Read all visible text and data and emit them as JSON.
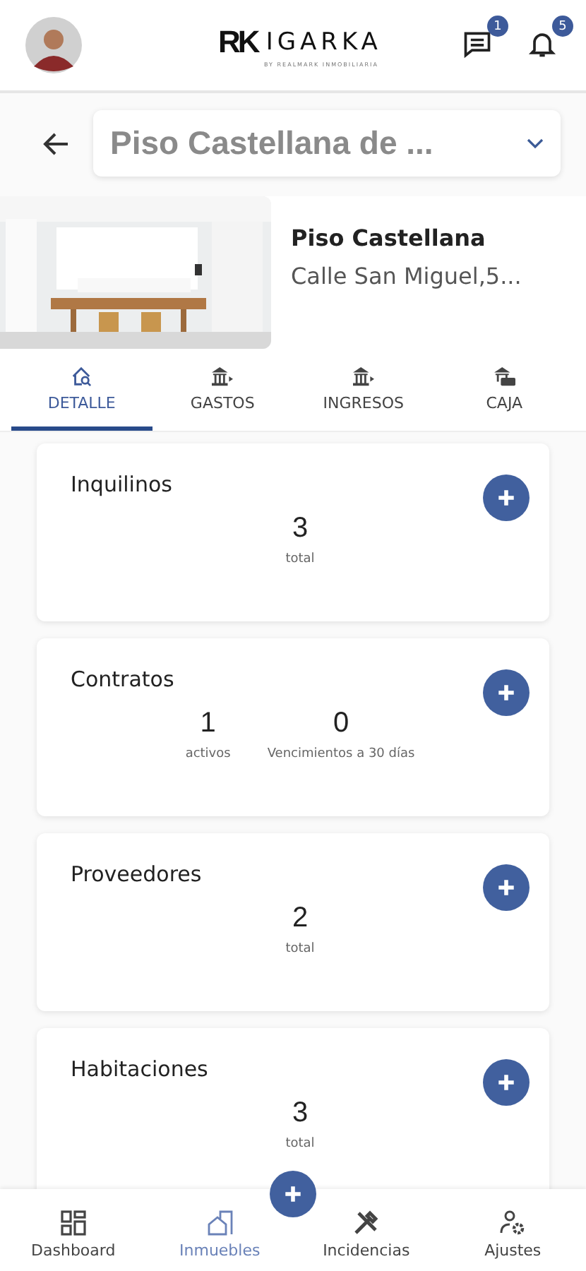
{
  "header": {
    "logo": {
      "mark": "RK",
      "name": "IGARKA",
      "tagline": "BY REALMARK INMOBILIARIA"
    },
    "messages_badge": "1",
    "notifications_badge": "5"
  },
  "property_select": {
    "value": "Piso Castellana de ..."
  },
  "property": {
    "name": "Piso Castellana",
    "address": "Calle San Miguel,5..."
  },
  "tabs": [
    {
      "label": "DETALLE",
      "kind": "detail",
      "selected": true
    },
    {
      "label": "GASTOS",
      "kind": "bank",
      "selected": false
    },
    {
      "label": "INGRESOS",
      "kind": "bank",
      "selected": false
    },
    {
      "label": "CAJA",
      "kind": "cash",
      "selected": false
    }
  ],
  "cards": [
    {
      "title": "Inquilinos",
      "stats": [
        {
          "value": "3",
          "label": "total"
        }
      ]
    },
    {
      "title": "Contratos",
      "stats": [
        {
          "value": "1",
          "label": "activos"
        },
        {
          "value": "0",
          "label": "Vencimientos a 30 días"
        }
      ]
    },
    {
      "title": "Proveedores",
      "stats": [
        {
          "value": "2",
          "label": "total"
        }
      ]
    },
    {
      "title": "Habitaciones",
      "stats": [
        {
          "value": "3",
          "label": "total"
        }
      ]
    }
  ],
  "bottom_nav": [
    {
      "label": "Dashboard",
      "kind": "dashboard",
      "selected": false
    },
    {
      "label": "Inmuebles",
      "kind": "building",
      "selected": true
    },
    {
      "label": "Incidencias",
      "kind": "tools",
      "selected": false
    },
    {
      "label": "Ajustes",
      "kind": "user-settings",
      "selected": false
    }
  ]
}
